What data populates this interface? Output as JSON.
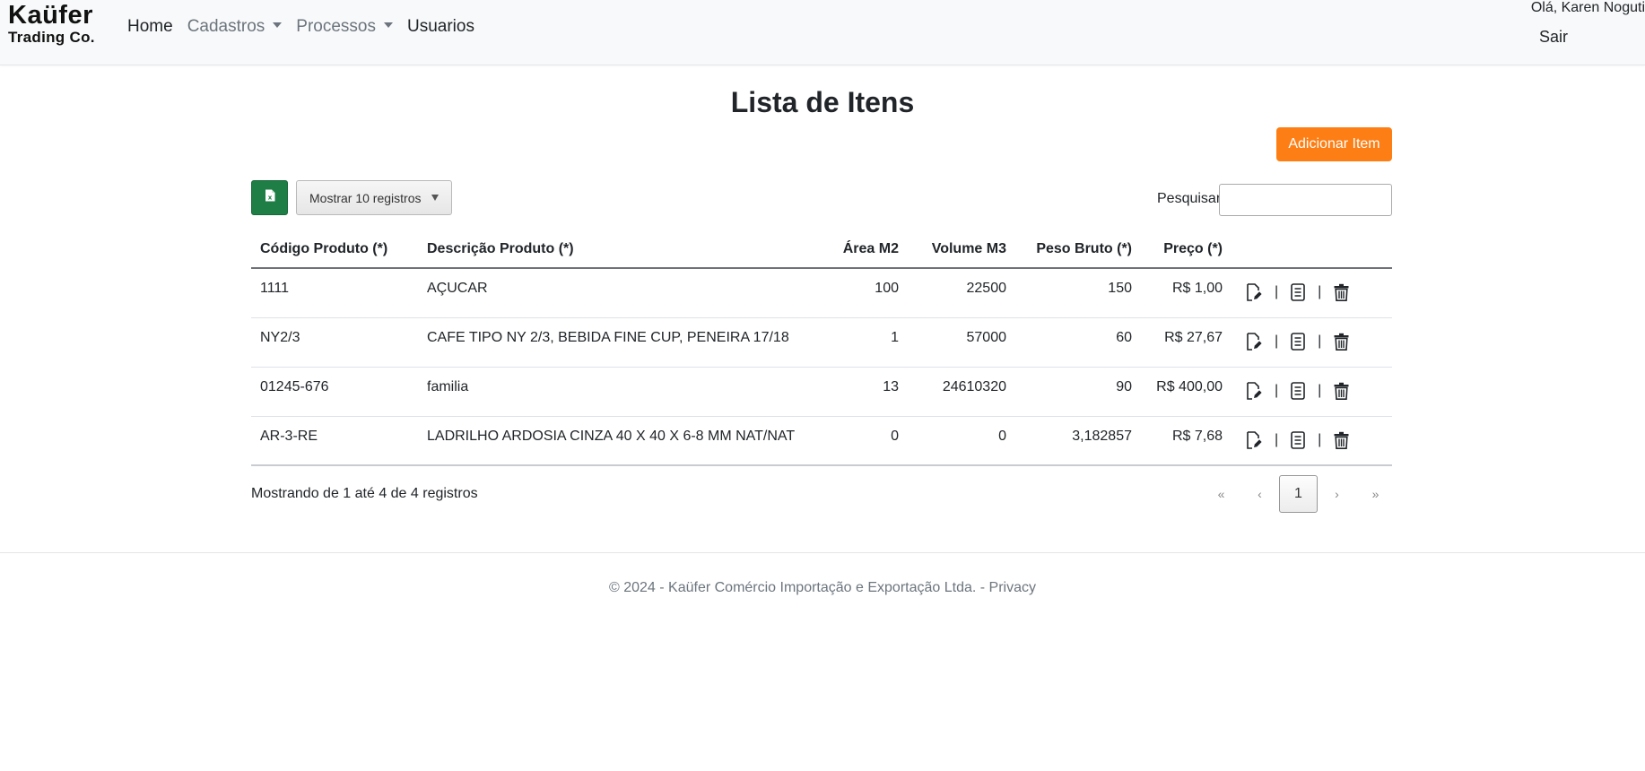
{
  "brand": {
    "line1": "Kaüfer",
    "line2": "Trading Co."
  },
  "nav": {
    "home": "Home",
    "cadastros": "Cadastros",
    "processos": "Processos",
    "usuarios": "Usuarios"
  },
  "user": {
    "greeting": "Olá, Karen Noguti",
    "logout": "Sair"
  },
  "page": {
    "title": "Lista de Itens",
    "add_button": "Adicionar Item"
  },
  "toolbar": {
    "excel_icon": "excel-file-icon",
    "length_label": "Mostrar 10 registros",
    "search_label": "Pesquisar",
    "search_value": ""
  },
  "table": {
    "headers": [
      "Código Produto (*)",
      "Descrição Produto (*)",
      "Área M2",
      "Volume M3",
      "Peso Bruto (*)",
      "Preço (*)"
    ],
    "rows": [
      {
        "codigo": "1111",
        "descricao": "AÇUCAR",
        "area": "100",
        "volume": "22500",
        "peso": "150",
        "preco": "R$ 1,00"
      },
      {
        "codigo": "NY2/3",
        "descricao": "CAFE TIPO NY 2/3, BEBIDA FINE CUP, PENEIRA 17/18",
        "area": "1",
        "volume": "57000",
        "peso": "60",
        "preco": "R$ 27,67"
      },
      {
        "codigo": "01245-676",
        "descricao": "familia",
        "area": "13",
        "volume": "24610320",
        "peso": "90",
        "preco": "R$ 400,00"
      },
      {
        "codigo": "AR-3-RE",
        "descricao": "LADRILHO ARDOSIA CINZA 40 X 40 X 6-8 MM NAT/NAT",
        "area": "0",
        "volume": "0",
        "peso": "3,182857",
        "preco": "R$ 7,68"
      }
    ],
    "row_action_separator": "|",
    "row_action_icons": [
      "edit-icon",
      "details-icon",
      "trash-icon"
    ]
  },
  "info": "Mostrando de 1 até 4 de 4 registros",
  "pagination": {
    "first": "«",
    "prev": "‹",
    "current": "1",
    "next": "›",
    "last": "»"
  },
  "footer": {
    "text": "© 2024 - Kaüfer Comércio Importação e Exportação Ltda. - ",
    "privacy": "Privacy"
  },
  "colors": {
    "accent_orange": "#fd7e14",
    "excel_green": "#1e7e45",
    "navbar_bg": "#f8f9fa",
    "muted_text": "#6c757d"
  }
}
